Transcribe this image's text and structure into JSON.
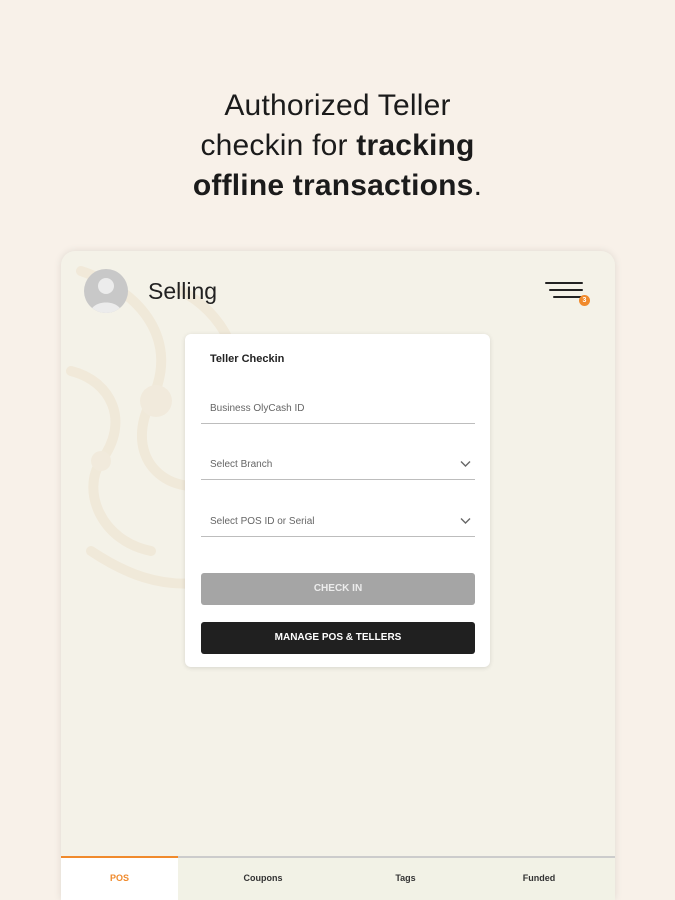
{
  "headline": {
    "line1": "Authorized Teller",
    "line2_regular": "checkin for ",
    "line2_bold": "tracking",
    "line3_bold": "offline transactions",
    "line3_end": "."
  },
  "app": {
    "title": "Selling",
    "menu_badge_count": "3",
    "avatar_icon": "user-silhouette-icon"
  },
  "checkin_card": {
    "title": "Teller Checkin",
    "business_id_placeholder": "Business OlyCash ID",
    "branch_placeholder": "Select Branch",
    "pos_placeholder": "Select POS ID or Serial",
    "checkin_label": "CHECK IN",
    "manage_label": "MANAGE POS & TELLERS"
  },
  "tabs": [
    {
      "label": "POS",
      "active": true
    },
    {
      "label": "Coupons",
      "active": false
    },
    {
      "label": "Tags",
      "active": false
    },
    {
      "label": "Funded",
      "active": false
    }
  ],
  "colors": {
    "accent": "#f08a2c",
    "page_background": "#f8f1e9",
    "device_background": "#f4f2e8",
    "primary_button": "#202020",
    "disabled_button": "#a5a5a5"
  }
}
